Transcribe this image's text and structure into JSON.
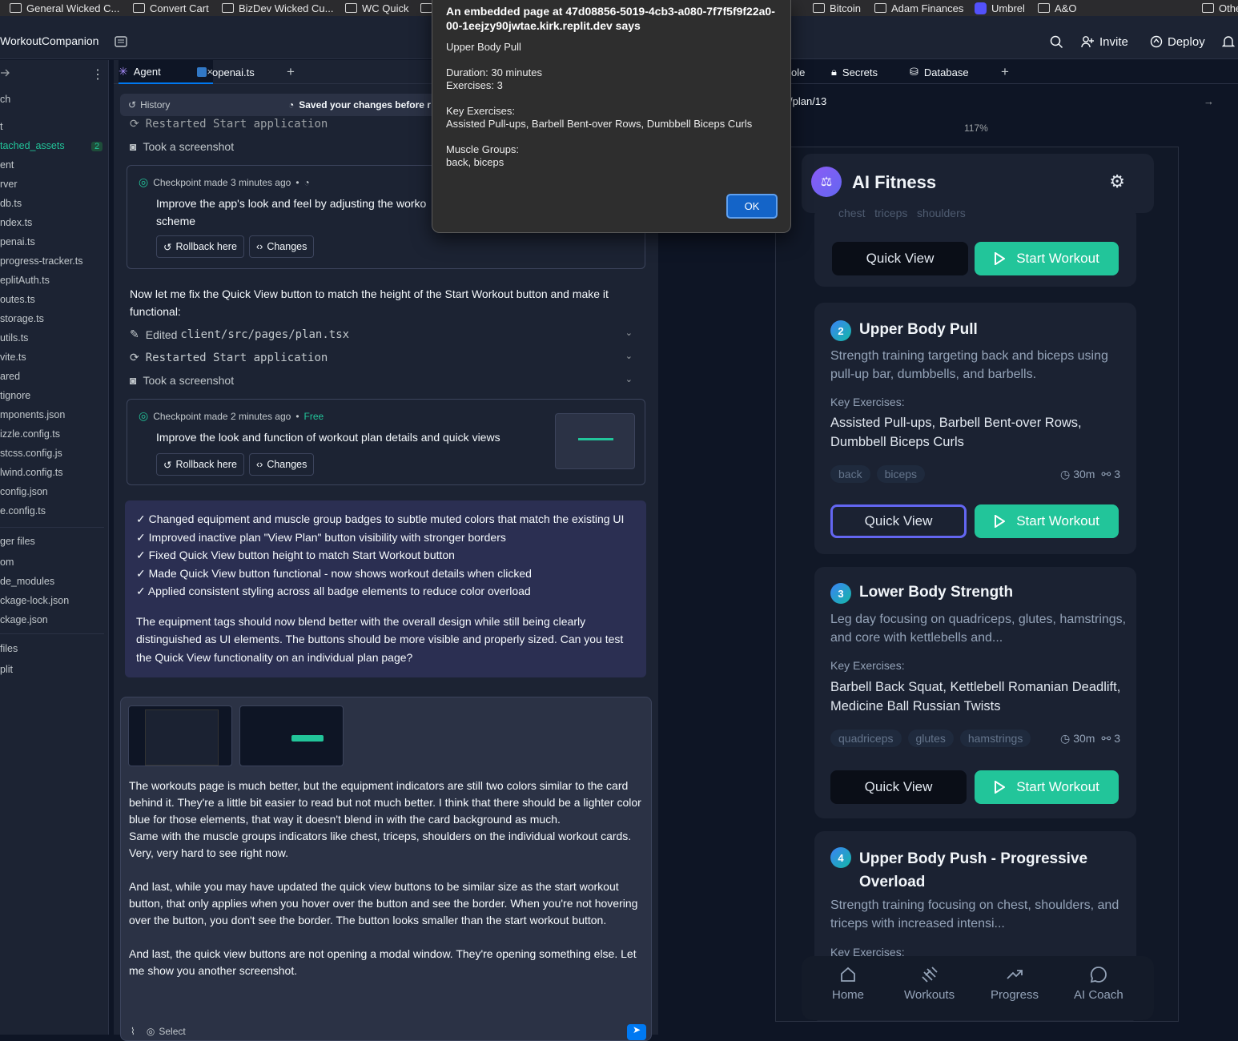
{
  "bookmarks": [
    {
      "label": "General Wicked C..."
    },
    {
      "label": "Convert Cart"
    },
    {
      "label": "BizDev Wicked Cu..."
    },
    {
      "label": "WC Quick"
    },
    {
      "label": "Bitcoin"
    },
    {
      "label": "Adam Finances"
    },
    {
      "label": "Umbrel"
    },
    {
      "label": "A&O"
    },
    {
      "label": "Othe"
    }
  ],
  "header": {
    "project": "WorkoutCompanion",
    "invite": "Invite",
    "deploy": "Deploy"
  },
  "filetree": {
    "items": [
      "ch",
      "t",
      "tached_assets",
      "ent",
      "rver",
      "db.ts",
      "ndex.ts",
      "penai.ts",
      "progress-tracker.ts",
      "eplitAuth.ts",
      "outes.ts",
      "storage.ts",
      "utils.ts",
      "vite.ts",
      "ared",
      "tignore",
      "mponents.json",
      "izzle.config.ts",
      "stcss.config.js",
      "lwind.config.ts",
      "config.json",
      "e.config.ts"
    ],
    "assets_badge": "2",
    "section2": [
      "ger files",
      "om",
      "de_modules",
      "ckage-lock.json",
      "ckage.json"
    ],
    "section3": [
      "files",
      "plit"
    ]
  },
  "center": {
    "tabs": {
      "agent": "Agent",
      "file": "openai.ts"
    },
    "history": "History",
    "saved": "Saved your changes before r",
    "actions": {
      "restarted1": "Restarted Start application",
      "screenshot1": "Took a screenshot",
      "edited": "Edited ",
      "edited_file": "client/src/pages/plan.tsx",
      "restarted2": "Restarted Start application",
      "screenshot2": "Took a screenshot"
    },
    "checkpoint1": {
      "meta": "Checkpoint made 3 minutes ago",
      "title": "Improve the app's look and feel by adjusting the worko scheme"
    },
    "checkpoint2": {
      "meta": "Checkpoint made 2 minutes ago",
      "free": "Free",
      "title": "Improve the look and function of workout plan details and quick views"
    },
    "rollback": "Rollback here",
    "changes": "Changes",
    "agent_msg": "Now let me fix the Quick View button to match the height of the Start Workout button and make it functional:",
    "summary": {
      "items": [
        "✓ Changed equipment and muscle group badges to subtle muted colors that match the existing UI",
        "✓ Improved inactive plan \"View Plan\" button visibility with stronger borders",
        "✓ Fixed Quick View button height to match Start Workout button",
        "✓ Made Quick View button functional - now shows workout details when clicked",
        "✓ Applied consistent styling across all badge elements to reduce color overload"
      ],
      "para": "The equipment tags should now blend better with the overall design while still being clearly distinguished as UI elements. The buttons should be more visible and properly sized. Can you test the Quick View functionality on an individual plan page?"
    },
    "user_msg": [
      "The workouts page is much better, but the equipment indicators are still two colors similar to the card behind it. They're a little bit easier to read but not much better. I think that there should be a lighter color blue for those elements, that way it doesn't blend in with the card background as much.\nSame with the muscle groups indicators like chest, triceps, shoulders on the individual workout cards. Very, very hard to see right now.",
      "And last, while you may have updated the quick view buttons to be similar size as the start workout button, that only applies when you hover over the button and see the border. When you're not hovering over the button, you don't see the border. The button looks smaller than the start workout button.",
      "And last, the quick view buttons are not opening a modal window. They're opening something else. Let me show you another screenshot."
    ],
    "select": "Select"
  },
  "right": {
    "tabs": {
      "console": "ole",
      "secrets": "Secrets",
      "database": "Database"
    },
    "url": "/plan/13",
    "url_prefix": "/",
    "zoom": "117%"
  },
  "app": {
    "title": "AI Fitness",
    "top_tags": "chest   triceps   shoulders",
    "cards": [
      {
        "num": "2",
        "title": "Upper Body Pull",
        "desc": "Strength training targeting back and biceps using pull-up bar, dumbbells, and barbells.",
        "ke_label": "Key Exercises:",
        "ke": "Assisted Pull-ups, Barbell Bent-over Rows, Dumbbell Biceps Curls",
        "tags": [
          "back",
          "biceps"
        ],
        "time": "30m",
        "count": "3"
      },
      {
        "num": "3",
        "title": "Lower Body Strength",
        "desc": "Leg day focusing on quadriceps, glutes, hamstrings, and core with kettlebells and...",
        "ke_label": "Key Exercises:",
        "ke": "Barbell Back Squat, Kettlebell Romanian Deadlift, Medicine Ball Russian Twists",
        "tags": [
          "quadriceps",
          "glutes",
          "hamstrings"
        ],
        "time": "30m",
        "count": "3"
      },
      {
        "num": "4",
        "title": "Upper Body Push - Progressive Overload",
        "desc": "Strength training focusing on chest, shoulders, and triceps with increased intensi...",
        "ke_label": "Key Exercises:"
      }
    ],
    "quick_view": "Quick View",
    "start_workout": "Start Workout",
    "nav": [
      "Home",
      "Workouts",
      "Progress",
      "AI Coach"
    ]
  },
  "dialog": {
    "title": "An embedded page at 47d08856-5019-4cb3-a080-7f7f5f9f22a0-00-1eejzy90jwtae.kirk.replit.dev says",
    "plan": "Upper Body Pull",
    "duration": "Duration: 30 minutes",
    "exercises": "Exercises: 3",
    "ke_label": "Key Exercises:",
    "ke": "Assisted Pull-ups, Barbell Bent-over Rows, Dumbbell Biceps Curls",
    "mg_label": "Muscle Groups:",
    "mg": "back, biceps",
    "ok": "OK"
  },
  "colors": {
    "accent": "#22c59a",
    "active_border": "#6366f1",
    "bg": "#0e1525",
    "panel": "#1c2333"
  }
}
